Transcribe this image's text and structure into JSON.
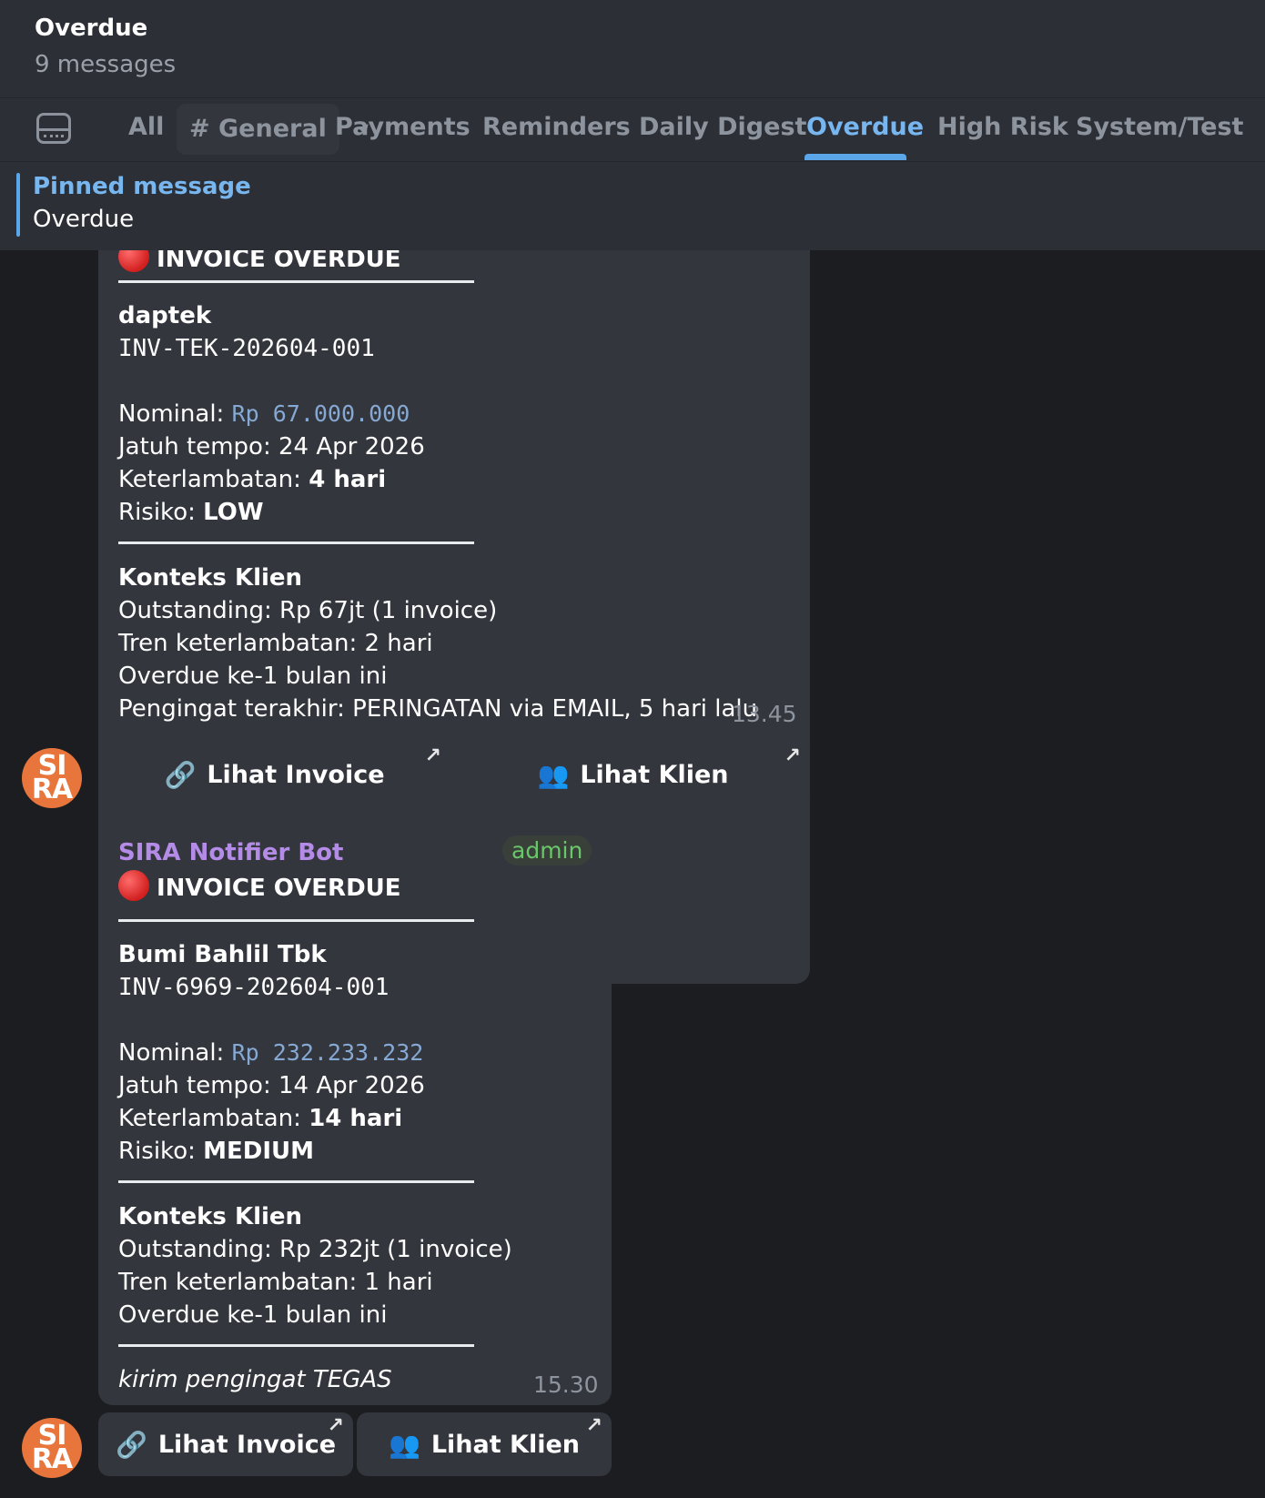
{
  "header": {
    "title": "Overdue",
    "subtitle": "9 messages"
  },
  "tabs": [
    {
      "label": "All"
    },
    {
      "label": "# General"
    },
    {
      "label": "Payments"
    },
    {
      "label": "Reminders"
    },
    {
      "label": "Daily Digest"
    },
    {
      "label": "Overdue",
      "active": true
    },
    {
      "label": "High Risk"
    },
    {
      "label": "System/Test"
    }
  ],
  "pinned": {
    "label": "Pinned message",
    "text": "Overdue"
  },
  "messages": [
    {
      "heading": "INVOICE OVERDUE",
      "client": "daptek",
      "invoice_no": "INV-TEK-202604-001",
      "nominal_label": "Nominal:",
      "nominal_value": "Rp 67.000.000",
      "due_label": "Jatuh tempo:",
      "due_value": "24 Apr 2026",
      "delay_label": "Keterlambatan:",
      "delay_value": "4 hari",
      "risk_label": "Risiko:",
      "risk_value": "LOW",
      "context_title": "Konteks Klien",
      "outstanding": "Outstanding: Rp 67jt (1 invoice)",
      "trend": "Tren keterlambatan: 2 hari",
      "overdue_count": "Overdue ke-1 bulan ini",
      "last_reminder": "Pengingat terakhir: PERINGATAN via EMAIL, 5 hari lalu",
      "time": "13.45",
      "buttons": {
        "invoice": "Lihat Invoice",
        "client": "Lihat Klien"
      },
      "avatar": "SI RA"
    },
    {
      "sender": "SIRA Notifier Bot",
      "role": "admin",
      "heading": "INVOICE OVERDUE",
      "client": "Bumi Bahlil Tbk",
      "invoice_no": "INV-6969-202604-001",
      "nominal_label": "Nominal:",
      "nominal_value": "Rp 232.233.232",
      "due_label": "Jatuh tempo:",
      "due_value": "14 Apr 2026",
      "delay_label": "Keterlambatan:",
      "delay_value": "14 hari",
      "risk_label": "Risiko:",
      "risk_value": "MEDIUM",
      "context_title": "Konteks Klien",
      "outstanding": "Outstanding: Rp 232jt (1 invoice)",
      "trend": "Tren keterlambatan: 1 hari",
      "overdue_count": "Overdue ke-1 bulan ini",
      "suggestion": "kirim pengingat TEGAS",
      "time": "15.30",
      "buttons": {
        "invoice": "Lihat Invoice",
        "client": "Lihat Klien"
      },
      "avatar": "SI RA"
    }
  ],
  "icons": {
    "tab_menu": "folders-icon",
    "link": "link-icon",
    "people": "people-icon",
    "external": "external-link-icon"
  },
  "colors": {
    "accent": "#5ba6e8",
    "sender": "#b48ce8",
    "admin": "#69c66a",
    "avatar": "#e8763c",
    "link_text": "#86a9d3"
  }
}
